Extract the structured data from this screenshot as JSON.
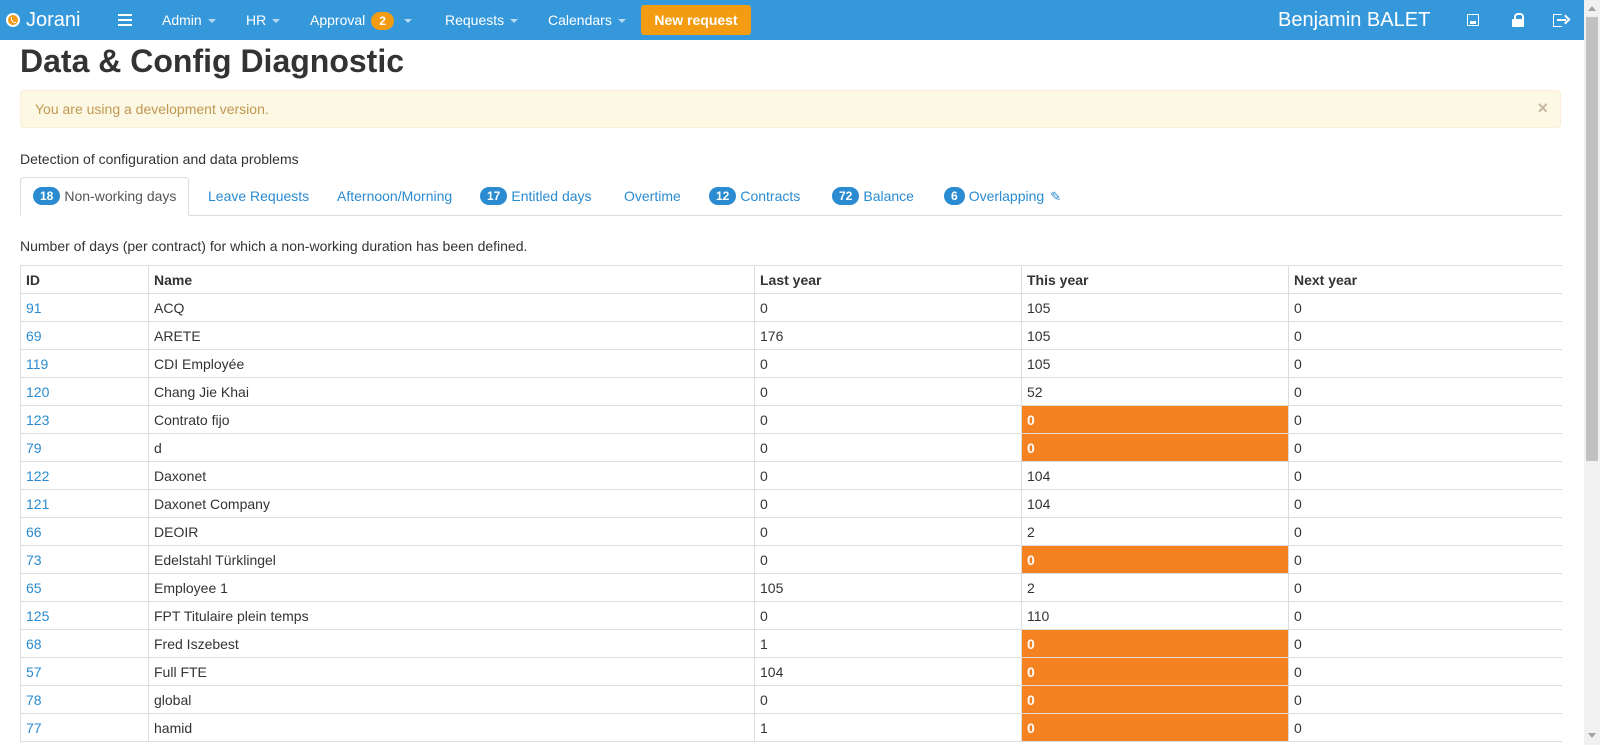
{
  "app": {
    "name": "Jorani"
  },
  "nav": {
    "items": [
      {
        "label": "Admin"
      },
      {
        "label": "HR"
      },
      {
        "label": "Approval",
        "badge": "2"
      },
      {
        "label": "Requests"
      },
      {
        "label": "Calendars"
      }
    ],
    "new_request": "New request",
    "user": "Benjamin BALET",
    "icons": [
      "menu-icon",
      "save-icon",
      "lock-icon",
      "logout-icon"
    ]
  },
  "page": {
    "title": "Data & Config Diagnostic",
    "alert": "You are using a development version.",
    "alert_close": "×",
    "subtitle": "Detection of configuration and data problems",
    "description": "Number of days (per contract) for which a non-working duration has been defined."
  },
  "tabs": [
    {
      "badge": "18",
      "label": "Non-working days",
      "active": true
    },
    {
      "badge": "",
      "label": "Leave Requests"
    },
    {
      "badge": "",
      "label": "Afternoon/Morning"
    },
    {
      "badge": "17",
      "label": "Entitled days"
    },
    {
      "badge": "",
      "label": "Overtime"
    },
    {
      "badge": "12",
      "label": "Contracts"
    },
    {
      "badge": "72",
      "label": "Balance"
    },
    {
      "badge": "6",
      "label": "Overlapping"
    }
  ],
  "table": {
    "headers": [
      "ID",
      "Name",
      "Last year",
      "This year",
      "Next year"
    ],
    "rows": [
      {
        "id": "91",
        "name": "ACQ",
        "last": "0",
        "this": "105",
        "next": "0",
        "warn": false
      },
      {
        "id": "69",
        "name": "ARETE",
        "last": "176",
        "this": "105",
        "next": "0",
        "warn": false
      },
      {
        "id": "119",
        "name": "CDI Employée",
        "last": "0",
        "this": "105",
        "next": "0",
        "warn": false
      },
      {
        "id": "120",
        "name": "Chang Jie Khai",
        "last": "0",
        "this": "52",
        "next": "0",
        "warn": false
      },
      {
        "id": "123",
        "name": "Contrato fijo",
        "last": "0",
        "this": "0",
        "next": "0",
        "warn": true
      },
      {
        "id": "79",
        "name": "d",
        "last": "0",
        "this": "0",
        "next": "0",
        "warn": true
      },
      {
        "id": "122",
        "name": "Daxonet",
        "last": "0",
        "this": "104",
        "next": "0",
        "warn": false
      },
      {
        "id": "121",
        "name": "Daxonet Company",
        "last": "0",
        "this": "104",
        "next": "0",
        "warn": false
      },
      {
        "id": "66",
        "name": "DEOIR",
        "last": "0",
        "this": "2",
        "next": "0",
        "warn": false
      },
      {
        "id": "73",
        "name": "Edelstahl Türklingel",
        "last": "0",
        "this": "0",
        "next": "0",
        "warn": true
      },
      {
        "id": "65",
        "name": "Employee 1",
        "last": "105",
        "this": "2",
        "next": "0",
        "warn": false
      },
      {
        "id": "125",
        "name": "FPT Titulaire plein temps",
        "last": "0",
        "this": "110",
        "next": "0",
        "warn": false
      },
      {
        "id": "68",
        "name": "Fred Iszebest",
        "last": "1",
        "this": "0",
        "next": "0",
        "warn": true
      },
      {
        "id": "57",
        "name": "Full FTE",
        "last": "104",
        "this": "0",
        "next": "0",
        "warn": true
      },
      {
        "id": "78",
        "name": "global",
        "last": "0",
        "this": "0",
        "next": "0",
        "warn": true
      },
      {
        "id": "77",
        "name": "hamid",
        "last": "1",
        "this": "0",
        "next": "0",
        "warn": true
      }
    ]
  },
  "colors": {
    "navbar": "#3498db",
    "accent": "#f39c12",
    "warning_cell": "#f58220",
    "link": "#2a8bd0"
  }
}
